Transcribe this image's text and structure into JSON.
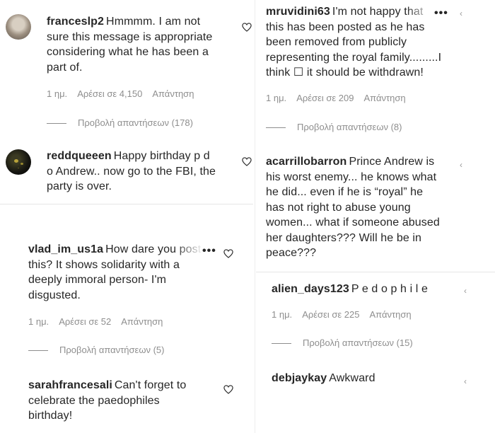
{
  "comments": {
    "frances": {
      "username": "franceslp2",
      "lines": [
        "Hmmmm. I am not",
        "sure this message is appropriate",
        "considering what he has been a",
        "part of."
      ],
      "time": "1 ημ.",
      "likes": "Αρέσει σε 4,150",
      "reply": "Απάντηση",
      "view_replies": "Προβολή απαντήσεων (178)"
    },
    "reddqueeen": {
      "username": "reddqueeen",
      "lines": [
        "Happy birthday p d",
        "o Andrew.. now go to the FBI, the",
        "party is over."
      ]
    },
    "vlad": {
      "username": "vlad_im_us1a",
      "lines": [
        "How dare you post",
        "this? It shows solidarity with a",
        "deeply immoral person- I'm",
        "disgusted."
      ],
      "time": "1 ημ.",
      "likes": "Αρέσει σε 52",
      "reply": "Απάντηση",
      "view_replies": "Προβολή απαντήσεων (5)"
    },
    "sarah": {
      "username": "sarahfrancesali",
      "lines": [
        "Can't forget to",
        "celebrate the paedophiles",
        "birthday!"
      ]
    },
    "mruvidini": {
      "username": "mruvidini63",
      "lines": [
        "I'm not happy that",
        "this has been posted as he has",
        "been removed from publicly",
        "representing the royal family.........I",
        "think ☐ it should be withdrawn!"
      ],
      "time": "1 ημ.",
      "likes": "Αρέσει σε 209",
      "reply": "Απάντηση",
      "view_replies": "Προβολή απαντήσεων (8)"
    },
    "acarrillo": {
      "username": "acarrillobarron",
      "lines": [
        "Prince Andrew is",
        "his worst enemy... he knows what",
        "he did... even if he is “royal” he",
        "has not right to abuse young",
        "women... what if someone abused",
        "her daughters??? Will he be in",
        "peace???"
      ]
    },
    "alien": {
      "username": "alien_days123",
      "lines": [
        "P e d o p h i l e"
      ],
      "time": "1 ημ.",
      "likes": "Αρέσει σε 225",
      "reply": "Απάντηση",
      "view_replies": "Προβολή απαντήσεων (15)"
    },
    "debjaykay": {
      "username": "debjaykay",
      "lines": [
        "Awkward"
      ]
    }
  },
  "icons": {
    "like": "heart-icon",
    "more": "more-options-icon",
    "chevron": "chevron-icon"
  },
  "colors": {
    "text": "#262626",
    "muted": "#8e8e8e",
    "heart": "#262626"
  }
}
